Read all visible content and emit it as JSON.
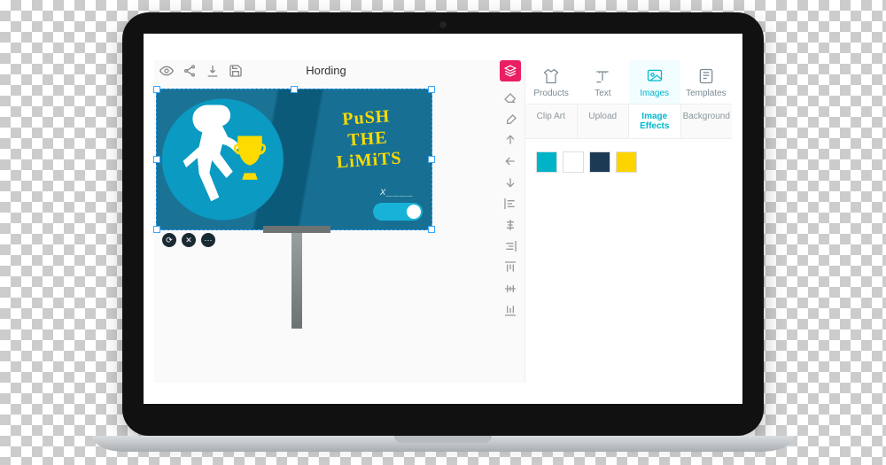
{
  "editor": {
    "title": "Hording",
    "top_tools": [
      "eye-icon",
      "share-icon",
      "download-icon",
      "save-icon"
    ],
    "layers_tool": "layers-icon",
    "side_tools": [
      "eraser-icon",
      "pencil-icon",
      "arrow-up-icon",
      "arrow-left-icon",
      "arrow-down-icon",
      "align-left-icon",
      "align-center-h-icon",
      "align-right-icon",
      "align-top-icon",
      "align-center-v-icon",
      "align-bottom-icon"
    ],
    "object_tools": [
      "rotate-icon",
      "delete-icon",
      "more-icon"
    ]
  },
  "design": {
    "slogan_line1": "PuSH",
    "slogan_line2": "THE",
    "slogan_line3": "LiMiTS",
    "signature": "x____",
    "bg_color": "#0e6a8f",
    "accent_color": "#fddb00"
  },
  "panel": {
    "tabs": [
      {
        "key": "products",
        "label": "Products"
      },
      {
        "key": "text",
        "label": "Text"
      },
      {
        "key": "images",
        "label": "Images"
      },
      {
        "key": "templates",
        "label": "Templates"
      }
    ],
    "active_tab": "images",
    "subtabs": [
      {
        "key": "clipart",
        "label": "Clip Art"
      },
      {
        "key": "upload",
        "label": "Upload"
      },
      {
        "key": "effects",
        "label": "Image Effects"
      },
      {
        "key": "background",
        "label": "Background"
      }
    ],
    "active_subtab": "effects",
    "swatches": [
      "#00b3c6",
      "#ffffff",
      "#1d3a54",
      "#fdd400"
    ]
  }
}
